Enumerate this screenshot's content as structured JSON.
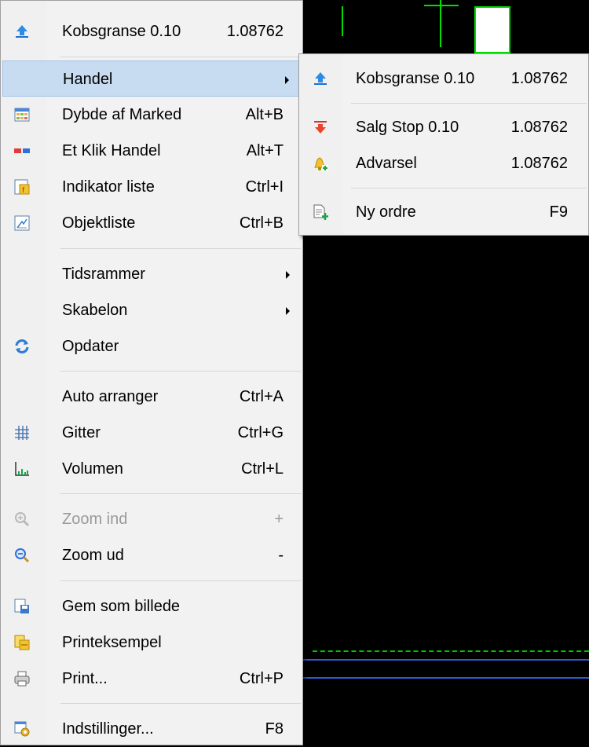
{
  "main_menu": {
    "items": [
      {
        "label": "Kobsgranse 0.10",
        "shortcut": "1.08762"
      },
      {
        "label": "Handel",
        "shortcut": ""
      },
      {
        "label": "Dybde af Marked",
        "shortcut": "Alt+B"
      },
      {
        "label": "Et Klik Handel",
        "shortcut": "Alt+T"
      },
      {
        "label": "Indikator liste",
        "shortcut": "Ctrl+I"
      },
      {
        "label": "Objektliste",
        "shortcut": "Ctrl+B"
      },
      {
        "label": "Tidsrammer",
        "shortcut": ""
      },
      {
        "label": "Skabelon",
        "shortcut": ""
      },
      {
        "label": "Opdater",
        "shortcut": ""
      },
      {
        "label": "Auto arranger",
        "shortcut": "Ctrl+A"
      },
      {
        "label": "Gitter",
        "shortcut": "Ctrl+G"
      },
      {
        "label": "Volumen",
        "shortcut": "Ctrl+L"
      },
      {
        "label": "Zoom ind",
        "shortcut": "+"
      },
      {
        "label": "Zoom ud",
        "shortcut": "-"
      },
      {
        "label": "Gem som billede",
        "shortcut": ""
      },
      {
        "label": "Printeksempel",
        "shortcut": ""
      },
      {
        "label": "Print...",
        "shortcut": "Ctrl+P"
      },
      {
        "label": "Indstillinger...",
        "shortcut": "F8"
      }
    ]
  },
  "sub_menu": {
    "items": [
      {
        "label": "Kobsgranse 0.10",
        "shortcut": "1.08762"
      },
      {
        "label": "Salg Stop 0.10",
        "shortcut": "1.08762"
      },
      {
        "label": "Advarsel",
        "shortcut": "1.08762"
      },
      {
        "label": "Ny ordre",
        "shortcut": "F9"
      }
    ]
  },
  "colors": {
    "highlight": "#c7dcf1",
    "chart_bg": "#000000",
    "chart_green": "#00e000",
    "chart_blue": "#2f5ad8"
  },
  "icons": [
    "buy-limit-icon",
    "market-depth-icon",
    "one-click-trading-icon",
    "indicator-list-icon",
    "object-list-icon",
    "refresh-icon",
    "grid-icon",
    "volume-icon",
    "zoom-in-icon",
    "zoom-out-icon",
    "save-image-icon",
    "print-preview-icon",
    "print-icon",
    "properties-icon",
    "sell-stop-icon",
    "alert-icon",
    "new-order-icon"
  ]
}
